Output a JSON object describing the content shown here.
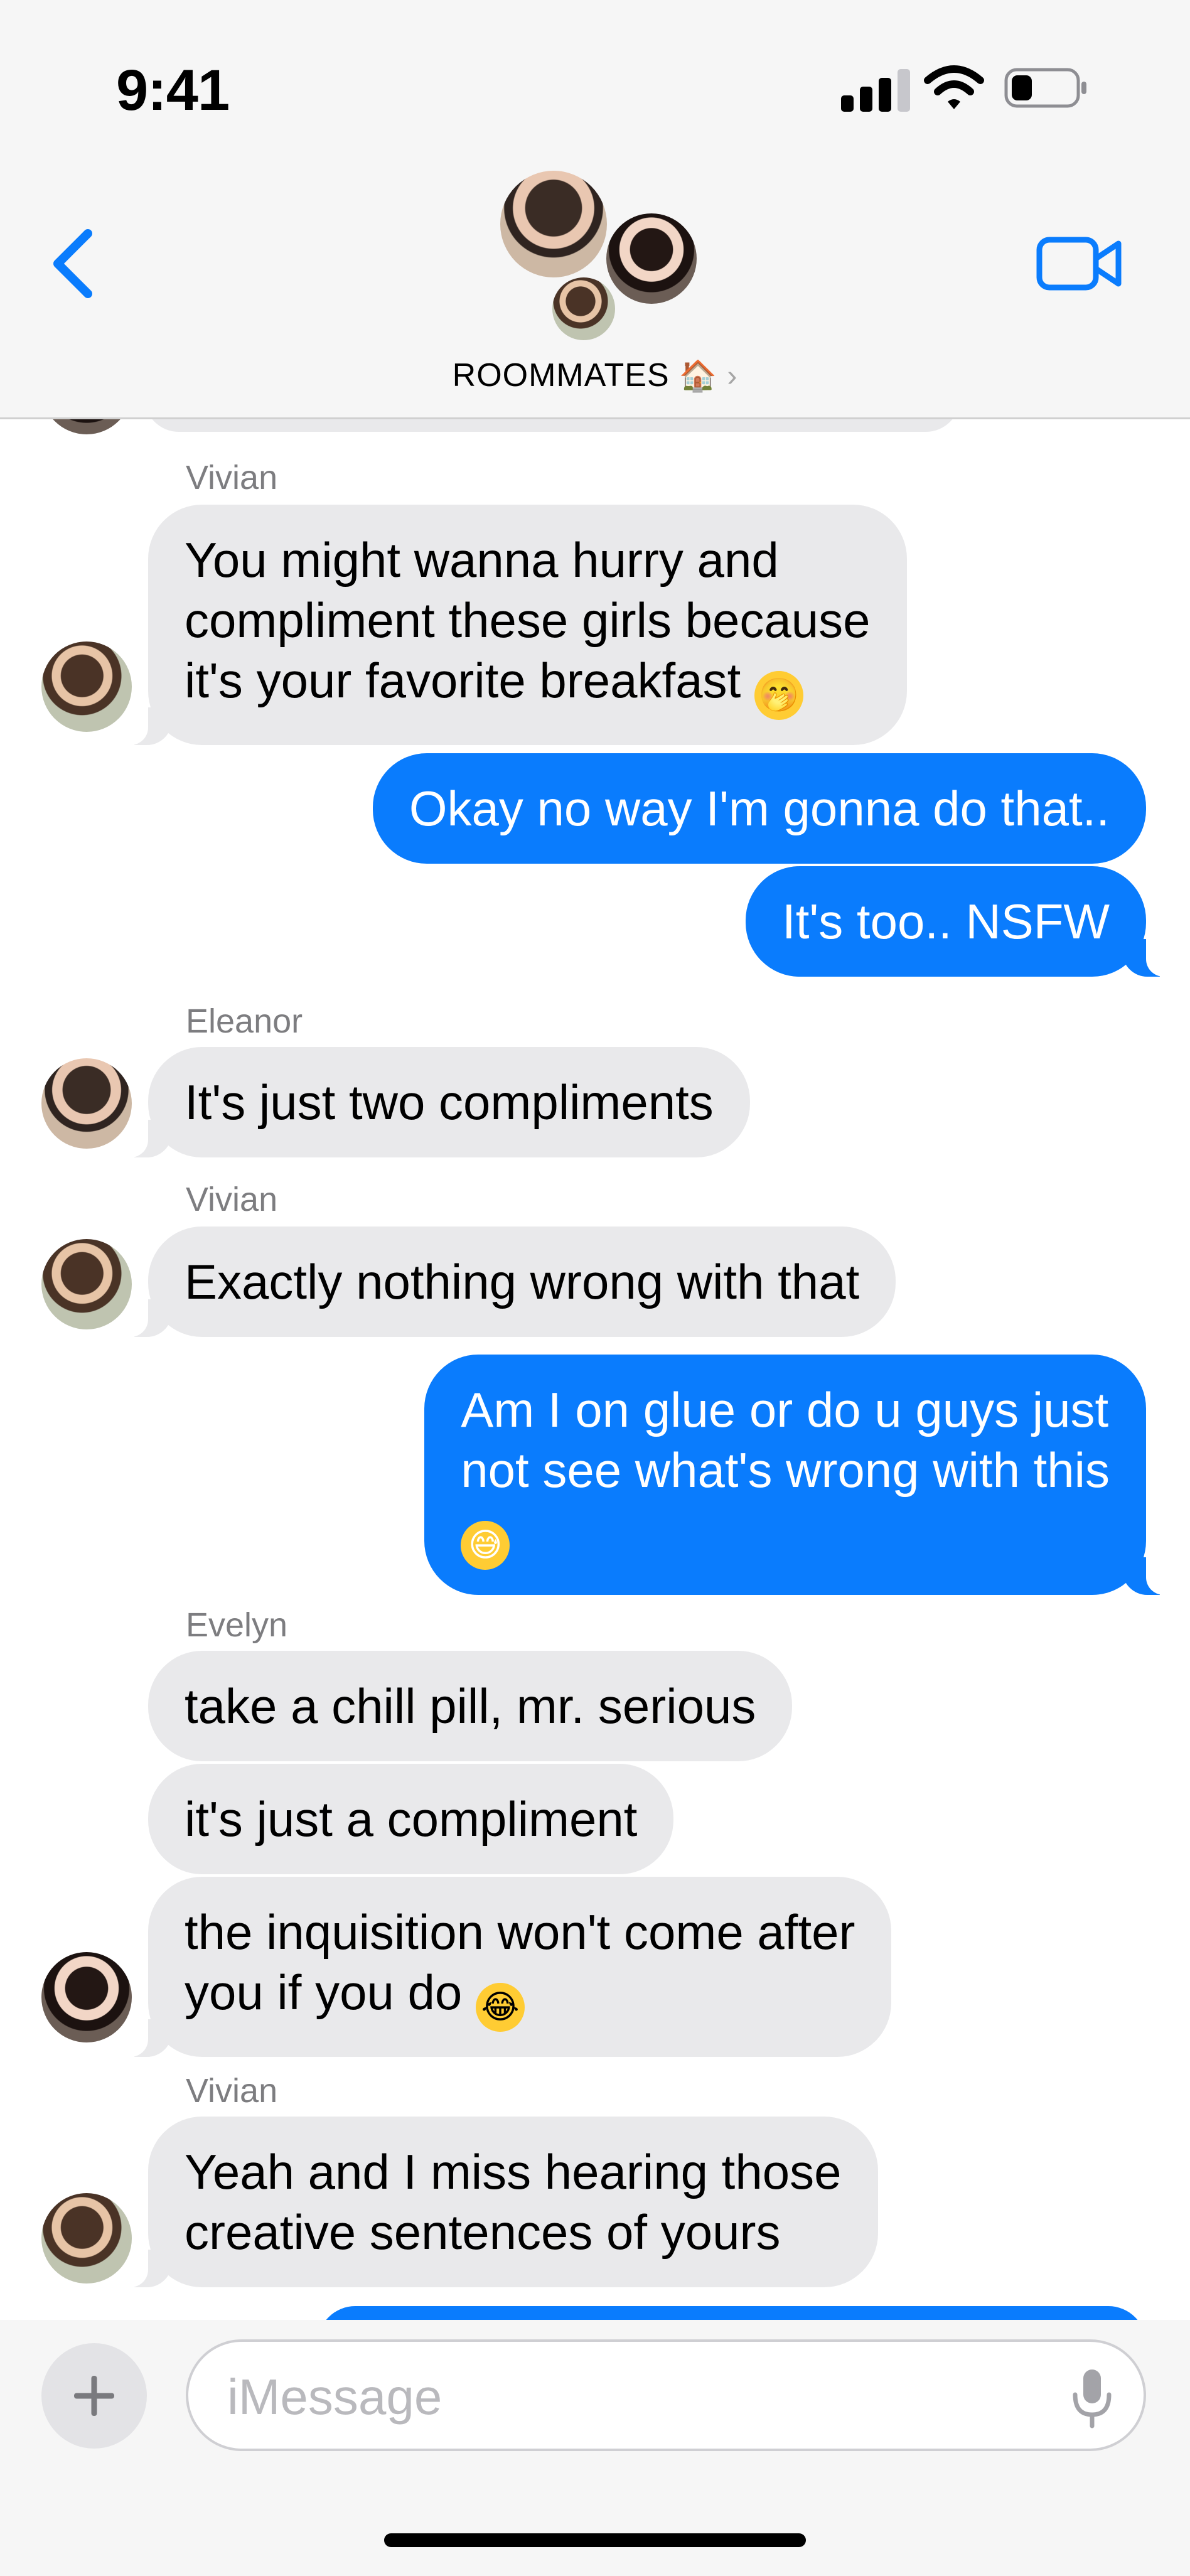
{
  "status_bar": {
    "time": "9:41"
  },
  "header": {
    "group_name": "ROOMMATES",
    "group_emoji": "🏠",
    "chevron": "›",
    "icons": [
      "back-chevron-icon",
      "video-call-icon"
    ]
  },
  "messages": [
    {
      "sender": "Vivian",
      "direction": "in",
      "lines": [
        "You might wanna hurry and",
        "compliment these girls because",
        "it's your favorite breakfast"
      ],
      "emoji": "🤭"
    },
    {
      "direction": "out",
      "lines": [
        "Okay no way I'm gonna do that.."
      ]
    },
    {
      "direction": "out",
      "lines": [
        "It's too.. NSFW"
      ]
    },
    {
      "sender": "Eleanor",
      "direction": "in",
      "lines": [
        "It's just two compliments"
      ]
    },
    {
      "sender": "Vivian",
      "direction": "in",
      "lines": [
        "Exactly nothing wrong with that"
      ]
    },
    {
      "direction": "out",
      "lines": [
        "Am I on glue or do u guys just",
        "not see what's wrong with this"
      ],
      "emoji": "😅"
    },
    {
      "sender": "Evelyn",
      "direction": "in",
      "lines": [
        "take a chill pill, mr. serious"
      ]
    },
    {
      "direction": "in",
      "lines": [
        "it's just a compliment"
      ]
    },
    {
      "direction": "in",
      "lines": [
        "the inquisition won't come after",
        "you if you do"
      ],
      "emoji": "😂"
    },
    {
      "sender": "Vivian",
      "direction": "in",
      "lines": [
        "Yeah and I miss hearing those",
        "creative sentences of yours"
      ]
    }
  ],
  "composer": {
    "placeholder": "iMessage",
    "value": ""
  },
  "colors": {
    "outgoing": "#0a7cfd",
    "incoming": "#e9e9eb",
    "sender_label": "#7d7d80"
  }
}
